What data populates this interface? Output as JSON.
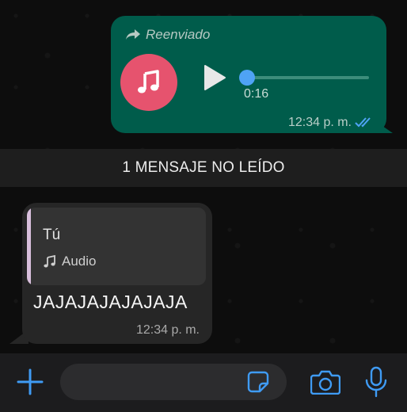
{
  "outgoing": {
    "forwarded_label": "Reenviado",
    "duration": "0:16",
    "time": "12:34 p. m.",
    "icons": {
      "forward": "forward-arrow-icon",
      "avatar": "music-note-icon",
      "play": "play-icon",
      "status": "double-check-read-icon"
    },
    "colors": {
      "bubble": "#005c4b",
      "avatar": "#e6536e",
      "progress": "#4fa3f5",
      "read_ticks": "#4fa3f5"
    },
    "progress": 0
  },
  "unread_banner": {
    "text": "1 MENSAJE NO LEÍDO"
  },
  "incoming": {
    "quote_author": "Tú",
    "quote_type": "Audio",
    "text": "JAJAJAJAJAJAJA",
    "time": "12:34 p. m.",
    "colors": {
      "bubble": "#262626",
      "quote_bar": "#d8bfdc"
    }
  },
  "input_bar": {
    "placeholder": "",
    "icons": [
      "plus-icon",
      "sticker-icon",
      "camera-icon",
      "microphone-icon"
    ],
    "accent": "#3f9bf4"
  }
}
